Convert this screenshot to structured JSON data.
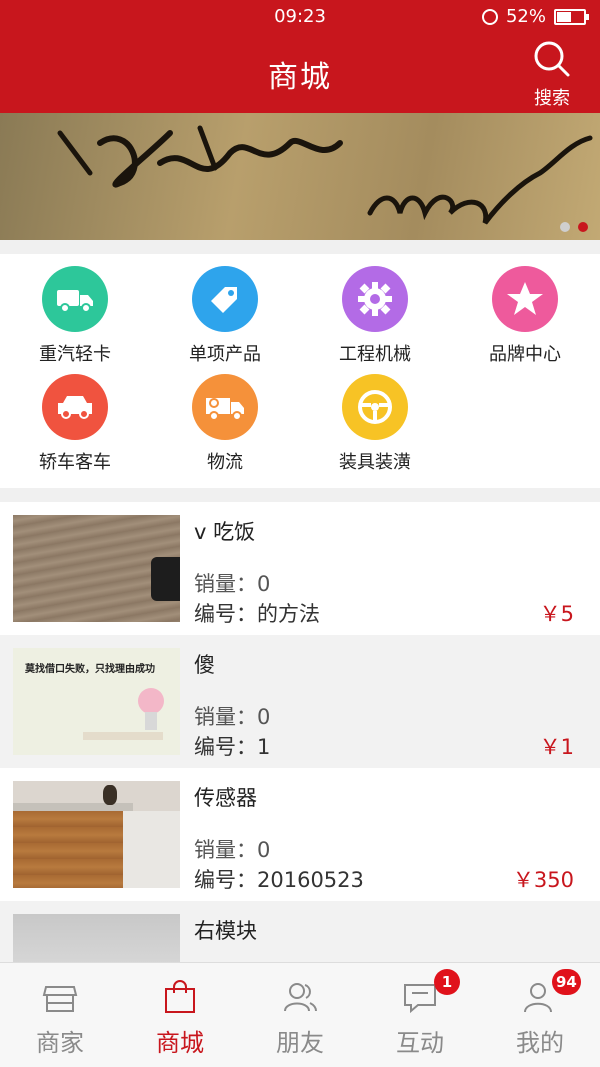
{
  "status_bar": {
    "time": "09:23",
    "battery": "52%",
    "battery_level": 0.52
  },
  "header": {
    "title": "商城",
    "search_label": "搜索"
  },
  "banner": {
    "dots": 2,
    "active_dot": 2
  },
  "categories": [
    {
      "label": "重汽轻卡",
      "icon": "truck-icon",
      "color": "#2dc79a"
    },
    {
      "label": "单项产品",
      "icon": "tag-icon",
      "color": "#2ea4ec"
    },
    {
      "label": "工程机械",
      "icon": "gear-icon",
      "color": "#b36be6"
    },
    {
      "label": "品牌中心",
      "icon": "star-icon",
      "color": "#ee5a9c"
    },
    {
      "label": "轿车客车",
      "icon": "car-icon",
      "color": "#f0533f"
    },
    {
      "label": "物流",
      "icon": "delivery-truck-icon",
      "color": "#f5913a"
    },
    {
      "label": "装具装潢",
      "icon": "steering-wheel-icon",
      "color": "#f7c325"
    }
  ],
  "products": [
    {
      "name": "v 吃饭",
      "sales": "销量：0",
      "code": "编号：的方法",
      "price": "￥5"
    },
    {
      "name": "傻",
      "sales": "销量：0",
      "code": "编号：1",
      "price": "￥1"
    },
    {
      "name": "传感器",
      "sales": "销量：0",
      "code": "编号：20160523",
      "price": "￥350"
    },
    {
      "name": "右模块",
      "sales": "",
      "code": "",
      "price": ""
    }
  ],
  "product_images": [
    {
      "caption": ""
    },
    {
      "caption": "莫找借口失败，只找理由成功"
    },
    {
      "caption": ""
    },
    {
      "caption": ""
    }
  ],
  "tabbar": [
    {
      "label": "商家",
      "icon": "store-icon",
      "badge": ""
    },
    {
      "label": "商城",
      "icon": "shopping-bag-icon",
      "badge": "",
      "active": true
    },
    {
      "label": "朋友",
      "icon": "friends-icon",
      "badge": ""
    },
    {
      "label": "互动",
      "icon": "chat-icon",
      "badge": "1"
    },
    {
      "label": "我的",
      "icon": "profile-icon",
      "badge": "94"
    }
  ],
  "colors": {
    "brand_red": "#c8161d",
    "badge_red": "#e0121b"
  }
}
